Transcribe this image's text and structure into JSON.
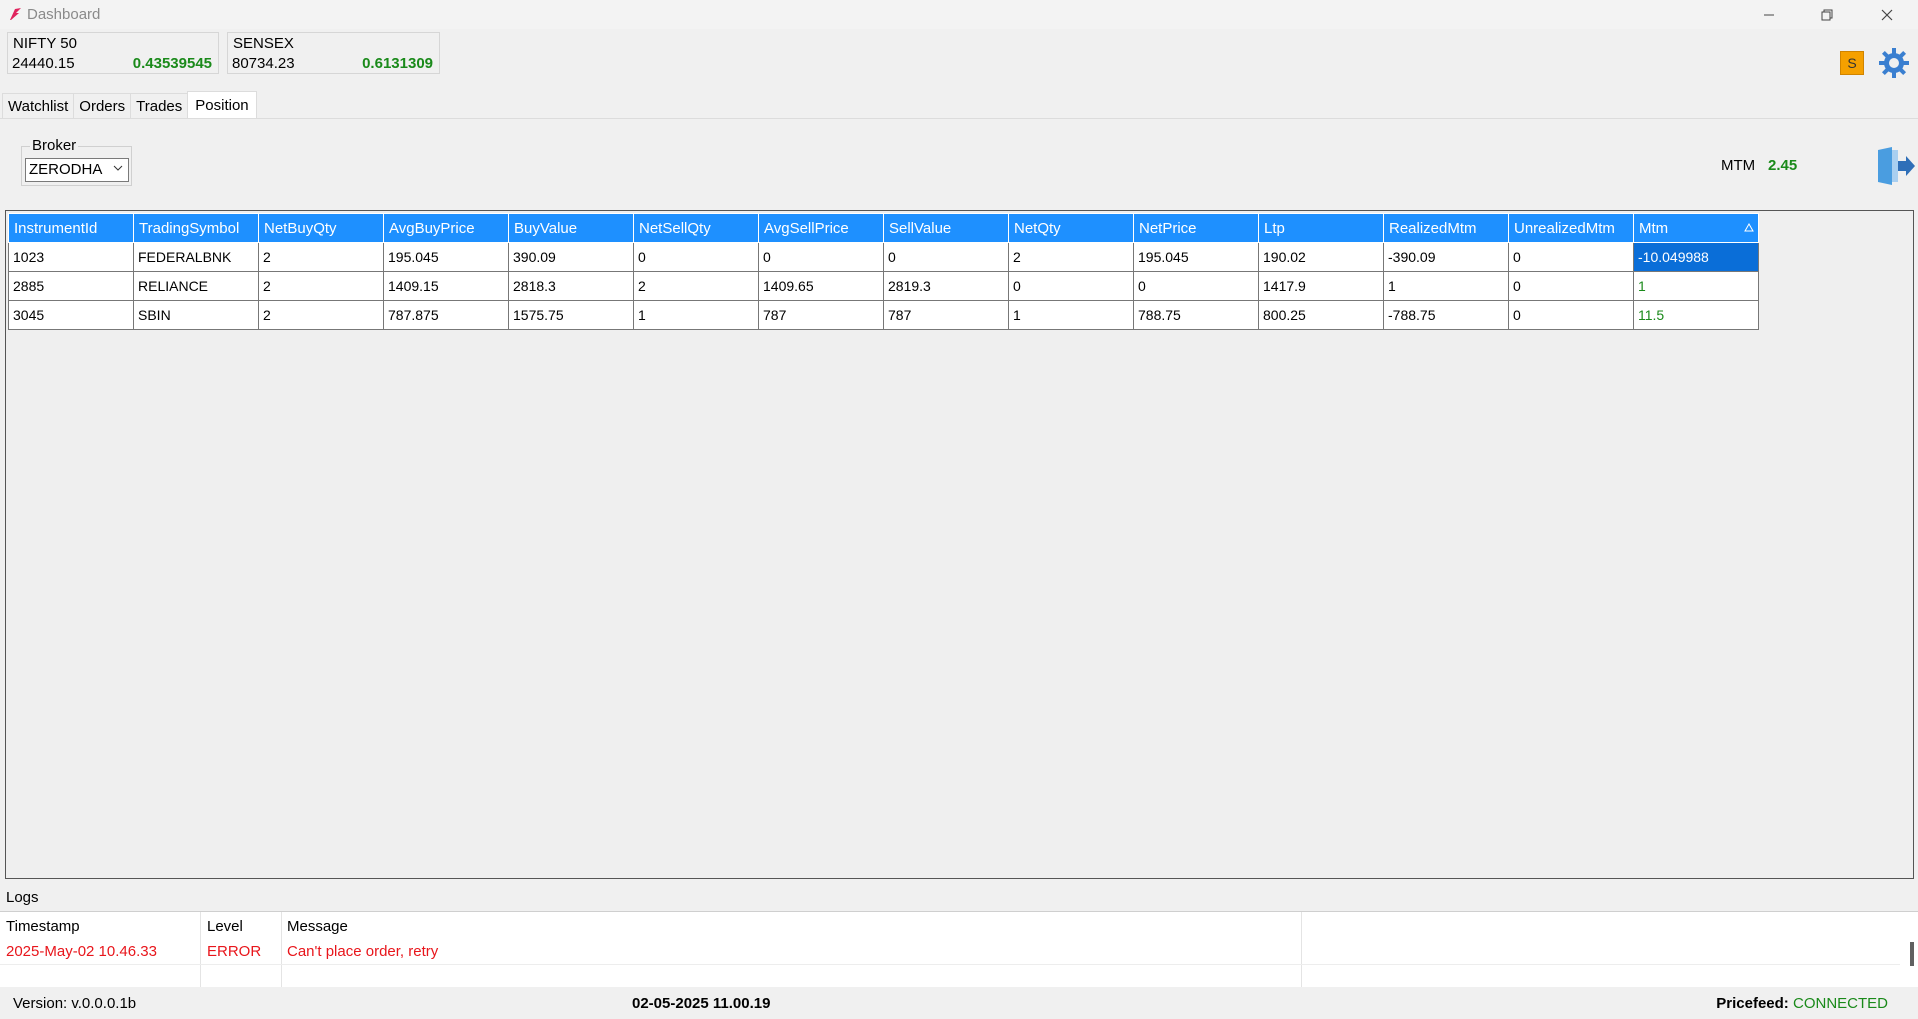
{
  "window": {
    "title": "Dashboard"
  },
  "indices": [
    {
      "name": "NIFTY 50",
      "value": "24440.15",
      "change": "0.43539545"
    },
    {
      "name": "SENSEX",
      "value": "80734.23",
      "change": "0.6131309"
    }
  ],
  "user": {
    "initial": "S"
  },
  "tabs": [
    "Watchlist",
    "Orders",
    "Trades",
    "Position"
  ],
  "active_tab": "Position",
  "broker": {
    "label": "Broker",
    "selected": "ZERODHA"
  },
  "mtm": {
    "label": "MTM",
    "value": "2.45"
  },
  "positions": {
    "columns": [
      "InstrumentId",
      "TradingSymbol",
      "NetBuyQty",
      "AvgBuyPrice",
      "BuyValue",
      "NetSellQty",
      "AvgSellPrice",
      "SellValue",
      "NetQty",
      "NetPrice",
      "Ltp",
      "RealizedMtm",
      "UnrealizedMtm",
      "Mtm"
    ],
    "rows": [
      [
        "1023",
        "FEDERALBNK",
        "2",
        "195.045",
        "390.09",
        "0",
        "0",
        "0",
        "2",
        "195.045",
        "190.02",
        "-390.09",
        "0",
        "-10.049988"
      ],
      [
        "2885",
        "RELIANCE",
        "2",
        "1409.15",
        "2818.3",
        "2",
        "1409.65",
        "2819.3",
        "0",
        "0",
        "1417.9",
        "1",
        "0",
        "1"
      ],
      [
        "3045",
        "SBIN",
        "2",
        "787.875",
        "1575.75",
        "1",
        "787",
        "787",
        "1",
        "788.75",
        "800.25",
        "-788.75",
        "0",
        "11.5"
      ]
    ]
  },
  "logs": {
    "title": "Logs",
    "columns": [
      "Timestamp",
      "Level",
      "Message"
    ],
    "rows": [
      {
        "timestamp": "2025-May-02 10.46.33",
        "level": "ERROR",
        "message": "Can't place order, retry"
      }
    ]
  },
  "status": {
    "version": "Version: v.0.0.0.1b",
    "datetime": "02-05-2025 11.00.19",
    "pricefeed_label": "Pricefeed:",
    "pricefeed_state": "CONNECTED"
  },
  "colors": {
    "header_blue": "#1e90ff",
    "positive_green": "#1a8a1a",
    "error_red": "#e8151b",
    "selection_blue": "#0a6ed8",
    "badge_orange": "#f5a000"
  }
}
